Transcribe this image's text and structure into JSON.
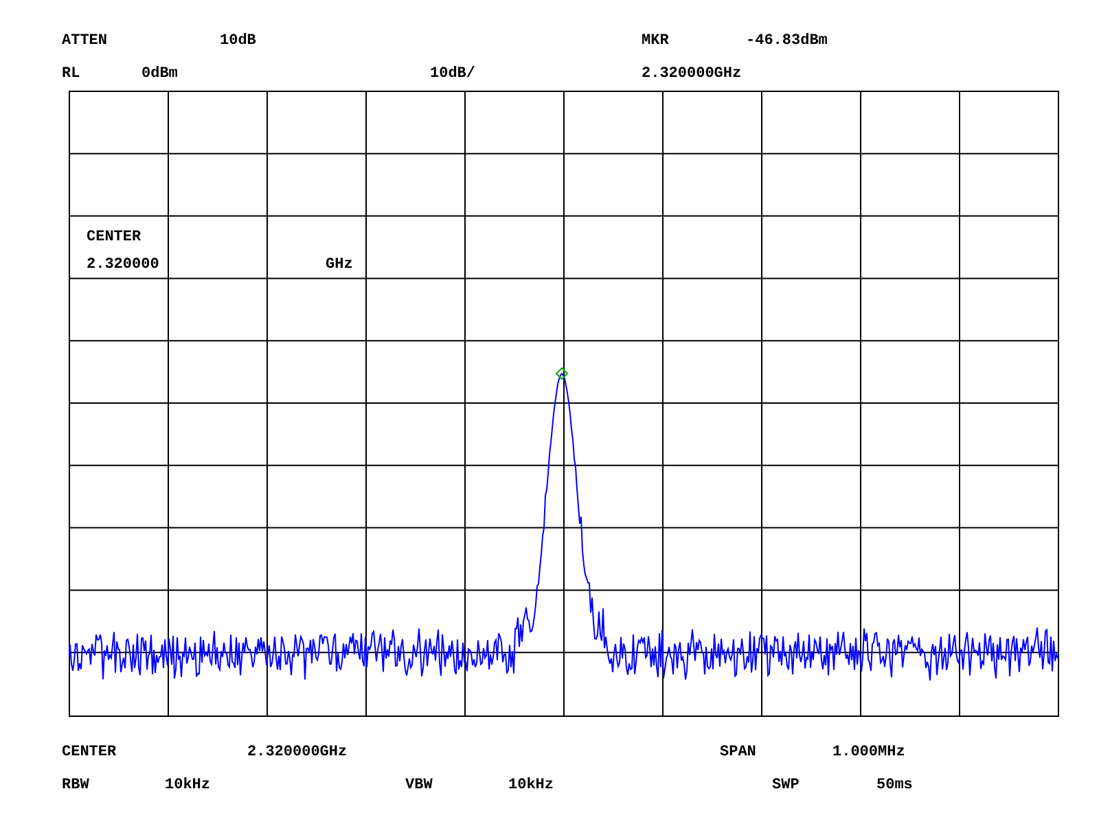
{
  "header": {
    "row_1": [
      "ATTEN",
      "10dB",
      "MKR",
      "-46.83dBm"
    ],
    "row_2": [
      "RL",
      "0dBm",
      "10dB/",
      "2.320000GHz"
    ]
  },
  "display": {
    "center_label": "CENTER",
    "center_value": "2.320000",
    "center_unit": "GHz"
  },
  "footer": {
    "row_1": [
      "CENTER",
      "2.320000GHz",
      "SPAN",
      "1.000MHz"
    ],
    "row_2": [
      "RBW",
      "10kHz",
      "VBW",
      "10kHz",
      "SWP",
      "50ms"
    ]
  }
}
